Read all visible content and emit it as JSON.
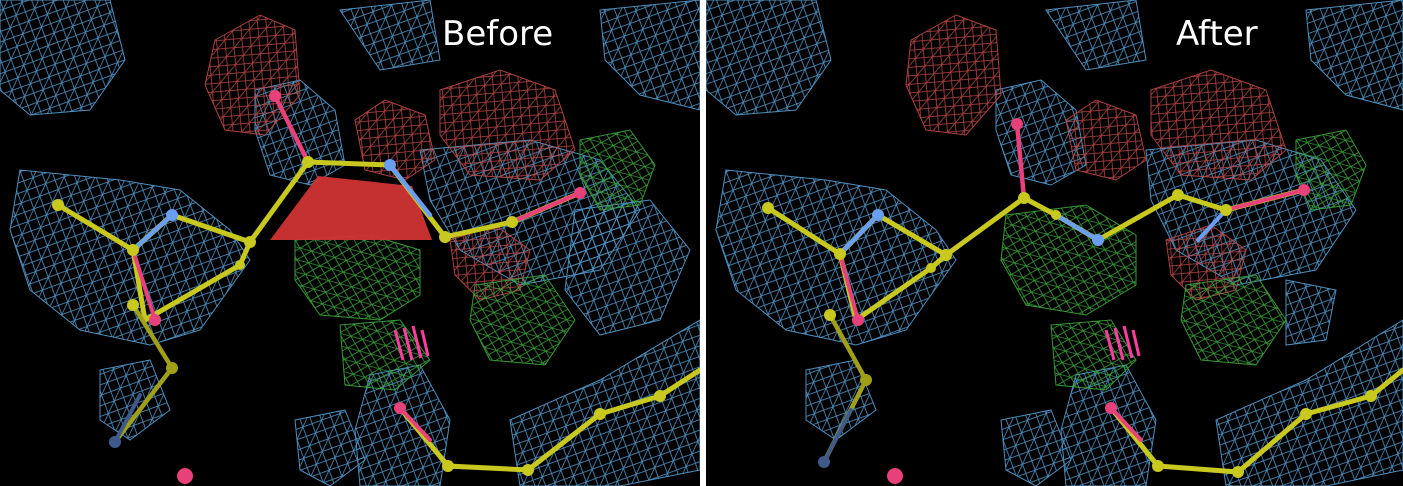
{
  "panels": [
    {
      "id": "before",
      "label": "Before",
      "show_distortion": true
    },
    {
      "id": "after",
      "label": "After",
      "show_distortion": false
    }
  ],
  "colors": {
    "background": "#000000",
    "divider": "#ffffff",
    "density_mesh": "#5aa8e0",
    "negative_difference_mesh": "#c04848",
    "positive_difference_mesh": "#3ca83c",
    "carbon_bond": "#c8c81e",
    "nitrogen": "#6a9ef0",
    "oxygen": "#e8407a",
    "distortion_plane": "#d03434",
    "contact_marker": "#ff3ca0"
  }
}
